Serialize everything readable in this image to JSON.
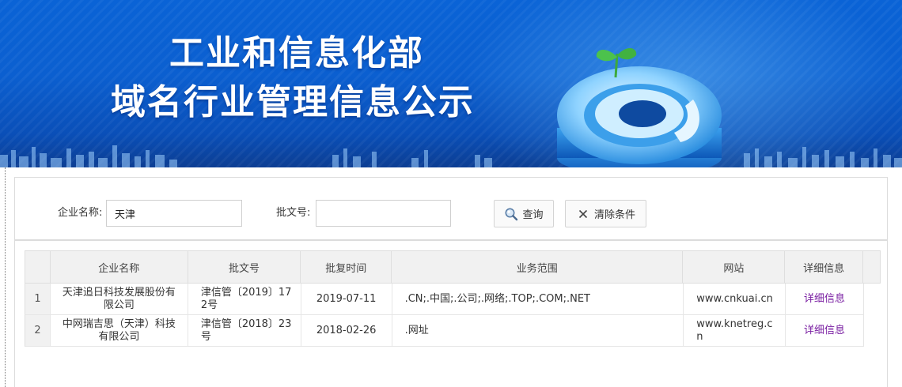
{
  "banner": {
    "title_line1": "工业和信息化部",
    "title_line2": "域名行业管理信息公示"
  },
  "search": {
    "company_label": "企业名称:",
    "company_value": "天津",
    "approval_label": "批文号:",
    "approval_value": "",
    "query_button": "查询",
    "clear_button": "清除条件"
  },
  "table": {
    "headers": [
      "企业名称",
      "批文号",
      "批复时间",
      "业务范围",
      "网站",
      "详细信息"
    ],
    "rows": [
      {
        "index": "1",
        "company": "天津追日科技发展股份有限公司",
        "approval_no": "津信管〔2019〕172号",
        "approval_date": "2019-07-11",
        "scope": ".CN;.中国;.公司;.网络;.TOP;.COM;.NET",
        "website": "www.cnkuai.cn",
        "detail": "详细信息"
      },
      {
        "index": "2",
        "company": "中网瑞吉思（天津）科技有限公司",
        "approval_no": "津信管〔2018〕23号",
        "approval_date": "2018-02-26",
        "scope": ".网址",
        "website": "www.knetreg.cn",
        "detail": "详细信息"
      }
    ]
  },
  "icons": {
    "query": "search-icon",
    "clear": "close-icon",
    "banner_logo": "at-sign-sprout-logo"
  },
  "colors": {
    "banner_blue": "#0a5fd0",
    "detail_link": "#7a1fa2",
    "header_bg": "#f1f1f1"
  }
}
